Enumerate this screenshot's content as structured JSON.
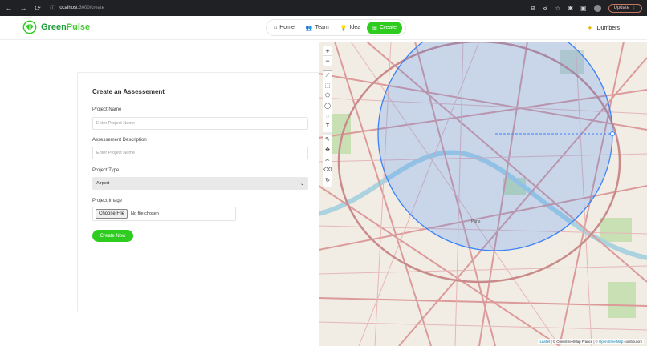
{
  "browser": {
    "url_host": "localhost",
    "url_path": ":3000/create",
    "update_label": "Update"
  },
  "header": {
    "brand_green": "Green",
    "brand_pulse": "Pulse",
    "nav": [
      {
        "label": "Home",
        "icon": "home-icon"
      },
      {
        "label": "Team",
        "icon": "team-icon"
      },
      {
        "label": "Idea",
        "icon": "lightbulb-icon"
      },
      {
        "label": "Create",
        "icon": "plus-square-icon",
        "active": true
      }
    ],
    "user_name": "Dumbers"
  },
  "form": {
    "title": "Create an Assessement",
    "project_name_label": "Project Name",
    "project_name_placeholder": "Enter Project Name",
    "description_label": "Assessement Description",
    "description_placeholder": "Enter Project Name",
    "type_label": "Project Type",
    "type_value": "Airport",
    "image_label": "Project Image",
    "choose_file_label": "Choose File",
    "no_file_text": "No file chosen",
    "submit_label": "Create Now"
  },
  "map": {
    "city_label": "Paris",
    "attribution_leaflet": "Leaflet",
    "attribution_text": " | © OpenStreetMap France | © ",
    "attribution_osm": "OpenStreetMap",
    "attribution_tail": " contributors",
    "colors": {
      "circle": "#3b82f6",
      "road": "#d98a8a",
      "park": "#b9d9a4",
      "water": "#aad3df"
    }
  }
}
